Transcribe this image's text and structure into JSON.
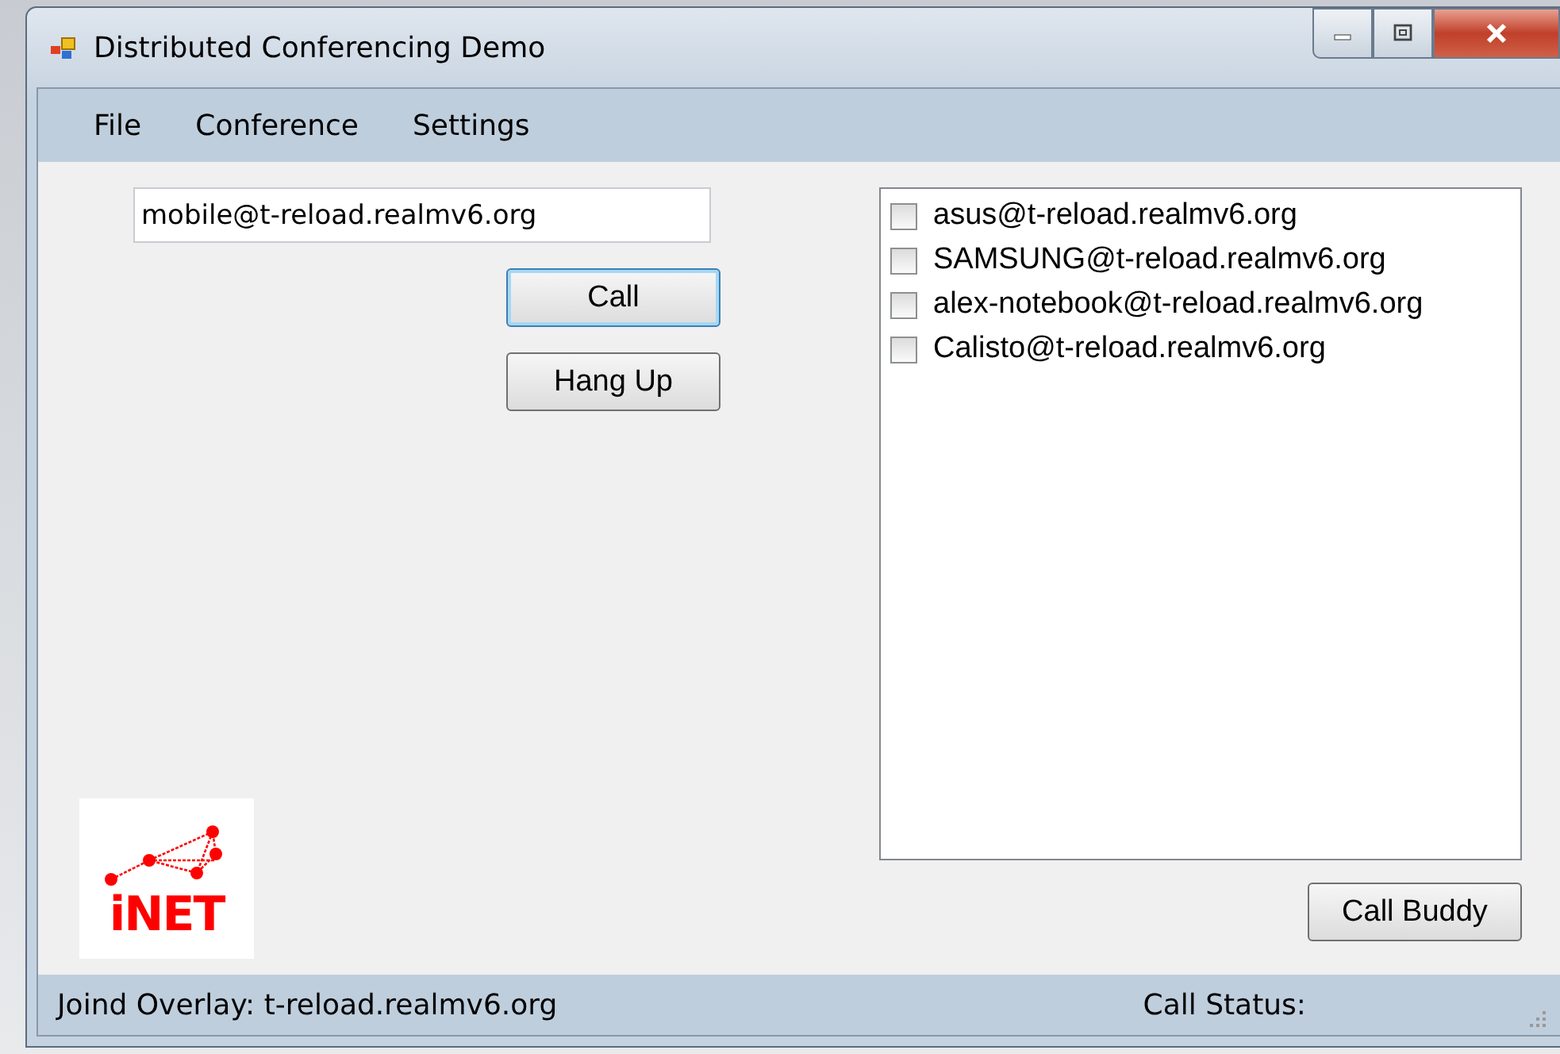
{
  "window": {
    "title": "Distributed Conferencing Demo"
  },
  "menu": [
    "File",
    "Conference",
    "Settings"
  ],
  "address_field": {
    "value": "mobile@t-reload.realmv6.org"
  },
  "buttons": {
    "call": "Call",
    "hang_up": "Hang Up",
    "call_buddy": "Call Buddy"
  },
  "buddies": [
    {
      "label": "asus@t-reload.realmv6.org",
      "checked": false
    },
    {
      "label": "SAMSUNG@t-reload.realmv6.org",
      "checked": false
    },
    {
      "label": "alex-notebook@t-reload.realmv6.org",
      "checked": false
    },
    {
      "label": "Calisto@t-reload.realmv6.org",
      "checked": false
    }
  ],
  "logo": {
    "text": "iNET"
  },
  "status_bar": {
    "overlay": "Joind Overlay: t-reload.realmv6.org",
    "call_status": "Call Status:"
  }
}
